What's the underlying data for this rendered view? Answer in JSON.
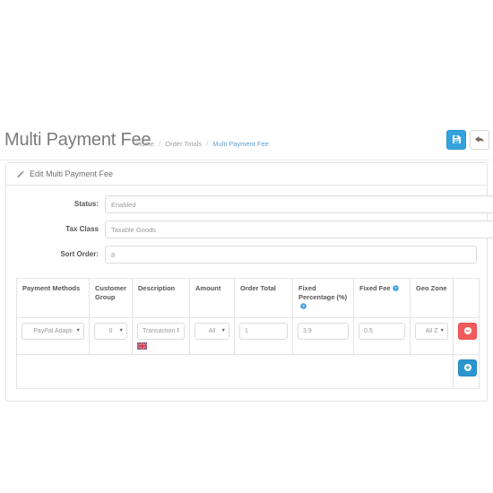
{
  "header": {
    "title": "Multi Payment Fee",
    "breadcrumb": [
      {
        "label": "Home",
        "active": false
      },
      {
        "label": "Order Totals",
        "active": false
      },
      {
        "label": "Multi Payment Fee",
        "active": true
      }
    ],
    "separator": "/",
    "buttons": {
      "save": {
        "icon": "save-icon",
        "label": ""
      },
      "back": {
        "icon": "back-arrow-icon",
        "label": ""
      }
    }
  },
  "panel": {
    "title": "Edit Multi Payment Fee",
    "icon": "pencil-icon"
  },
  "form": {
    "fields": [
      {
        "label": "Status:",
        "value": "Enabled",
        "type": "select"
      },
      {
        "label": "Tax Class",
        "value": "Taxable Goods",
        "type": "select"
      },
      {
        "label": "Sort Order:",
        "value": "8",
        "type": "text"
      }
    ]
  },
  "table": {
    "headers": [
      {
        "label": "Payment Methods",
        "help": false
      },
      {
        "label": "Customer Group",
        "help": false
      },
      {
        "label": "Description",
        "help": false
      },
      {
        "label": "Amount",
        "help": false
      },
      {
        "label": "Order Total",
        "help": false
      },
      {
        "label": "Fixed Percentage (%)",
        "help": true
      },
      {
        "label": "Fixed Fee",
        "help": true
      },
      {
        "label": "Geo Zone",
        "help": false
      },
      {
        "label": "",
        "help": false
      }
    ],
    "rows": [
      {
        "payment_method": "PayPal Adapti",
        "customer_group": "0",
        "description": "Transaction F",
        "description_flag": "uk-flag-icon",
        "amount": "All",
        "order_total": "1",
        "fixed_percentage": "3.9",
        "fixed_fee": "0.5",
        "geo_zone": "All Z",
        "remove_icon": "minus-circle-icon"
      }
    ],
    "footer": {
      "add_icon": "plus-circle-icon"
    }
  },
  "colors": {
    "primary": "#2b95d0",
    "header_button": "#34a3dd",
    "danger": "#f15b5b",
    "link": "#5a9fd4",
    "help": "#3fa0dd"
  }
}
